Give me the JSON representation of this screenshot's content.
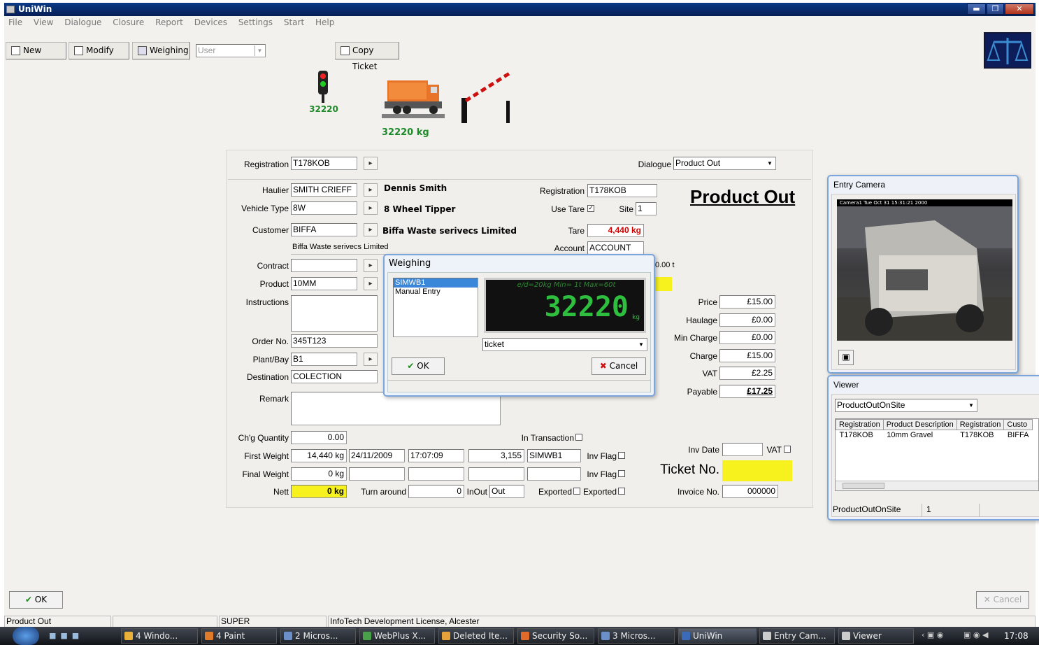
{
  "title": "UniWin",
  "window_buttons": [
    "▬",
    "❐",
    "✕"
  ],
  "menu": [
    "File",
    "View",
    "Dialogue",
    "Closure",
    "Report",
    "Devices",
    "Settings",
    "Start",
    "Help"
  ],
  "toolbar": {
    "new": "New",
    "modify": "Modify",
    "weighing": "Weighing",
    "user": "User",
    "copy_ticket": "Copy Ticket"
  },
  "scale": {
    "light_value": "32220",
    "truck_weight": "32220 kg"
  },
  "form": {
    "registration_label": "Registration",
    "registration": "T178KOB",
    "dialogue_label": "Dialogue",
    "dialogue": "Product Out",
    "heading": "Product Out",
    "haulier_label": "Haulier",
    "haulier": "SMITH CRIEFF",
    "haulier_name": "Dennis Smith",
    "vehicle_type_label": "Vehicle Type",
    "vehicle_type": "8W",
    "vehicle_desc": "8 Wheel Tipper",
    "customer_label": "Customer",
    "customer": "BIFFA",
    "customer_name": "Biffa Waste serivecs Limited",
    "customer_line2": "Biffa Waste serivecs Limited",
    "contract_label": "Contract",
    "contract": "",
    "product_label": "Product",
    "product": "10MM",
    "instructions_label": "Instructions",
    "order_label": "Order No.",
    "order": "345T123",
    "plant_label": "Plant/Bay",
    "plant": "B1",
    "destination_label": "Destination",
    "destination": "COLECTION",
    "remark_label": "Remark",
    "reg2_label": "Registration",
    "reg2": "T178KOB",
    "use_tare_label": "Use Tare",
    "use_tare_check": "✓",
    "site_label": "Site",
    "site": "1",
    "tare_label": "Tare",
    "tare": "4,440 kg",
    "account_label": "Account",
    "account": "ACCOUNT",
    "partial_value": "0.00 t",
    "price_label": "Price",
    "price": "£15.00",
    "haulage_label": "Haulage",
    "haulage": "£0.00",
    "min_charge_label": "Min Charge",
    "min_charge": "£0.00",
    "charge_label": "Charge",
    "charge": "£15.00",
    "vat_label": "VAT",
    "vat": "£2.25",
    "payable_label": "Payable",
    "payable": "£17.25",
    "chg_qty_label": "Ch'g Quantity",
    "chg_qty": "0.00",
    "in_transaction_label": "In Transaction",
    "first_weight_label": "First Weight",
    "first_weight": "14,440 kg",
    "first_date": "24/11/2009",
    "first_time": "17:07:09",
    "first_num": "3,155",
    "first_bridge": "SIMWB1",
    "inv_flag_label": "Inv Flag",
    "final_weight_label": "Final Weight",
    "final_weight": "0 kg",
    "nett_label": "Nett",
    "nett": "0 kg",
    "turnaround_label": "Turn around",
    "turnaround": "0",
    "inout_label": "InOut",
    "inout": "Out",
    "exported_label": "Exported",
    "inv_date_label": "Inv Date",
    "vat_flag_label": "VAT",
    "ticket_label": "Ticket No.",
    "invoice_label": "Invoice No.",
    "invoice": "000000"
  },
  "weighing_dialog": {
    "title": "Weighing",
    "list": [
      "SIMWB1",
      "Manual Entry"
    ],
    "display_header": "e/d=20kg  Min=  1t  Max=60t",
    "display_value": "32220",
    "display_unit": "kg",
    "ticket": "ticket",
    "ok": "OK",
    "cancel": "Cancel"
  },
  "camera": {
    "title": "Entry Camera",
    "overlay": "Camera1  Tue Oct 31 15:31:21 2000"
  },
  "viewer": {
    "title": "Viewer",
    "select": "ProductOutOnSite",
    "columns": [
      "Registration",
      "Product Description",
      "Registration",
      "Custo"
    ],
    "rows": [
      [
        "T178KOB",
        "10mm Gravel",
        "T178KOB",
        "BIFFA"
      ]
    ],
    "footer_name": "ProductOutOnSite",
    "footer_count": "1"
  },
  "bottom": {
    "ok": "OK",
    "cancel": "Cancel"
  },
  "statusbar": [
    "Product Out",
    "SUPER",
    "InfoTech Development License, Alcester"
  ],
  "taskbar": {
    "items": [
      "4 Windo...",
      "4 Paint",
      "2 Micros...",
      "WebPlus X...",
      "Deleted Ite...",
      "Security So...",
      "3 Micros...",
      "UniWin",
      "Entry Cam...",
      "Viewer"
    ],
    "clock": "17:08"
  },
  "colors": {
    "highlight_yellow": "#f7f21e",
    "tare_red": "#d00000",
    "lcd_green": "#2fbf3f",
    "title_blue": "#0b3a86"
  }
}
